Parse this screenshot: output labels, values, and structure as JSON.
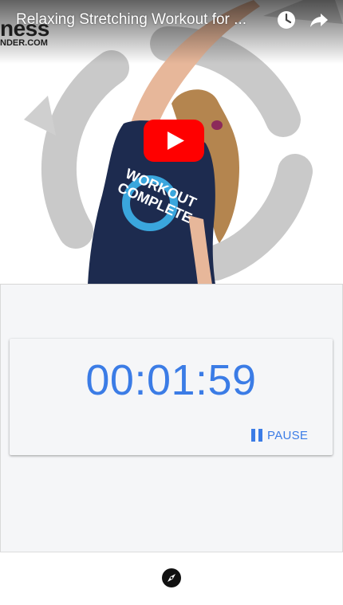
{
  "video": {
    "title": "Relaxing Stretching Workout for ...",
    "channel_logo_line1": "ness",
    "channel_logo_line2": "NDER.COM",
    "shirt_text_line1": "WORKOUT",
    "shirt_text_line2": "COMPLETE",
    "icons": [
      "watch-later-icon",
      "share-icon",
      "youtube-play-icon"
    ],
    "brand_red": "#ff0000"
  },
  "timer": {
    "display": "00:01:59",
    "pause_label": "PAUSE",
    "accent": "#3b7ce6"
  },
  "bottom_bar": {
    "icons": [
      "compass-icon"
    ]
  }
}
